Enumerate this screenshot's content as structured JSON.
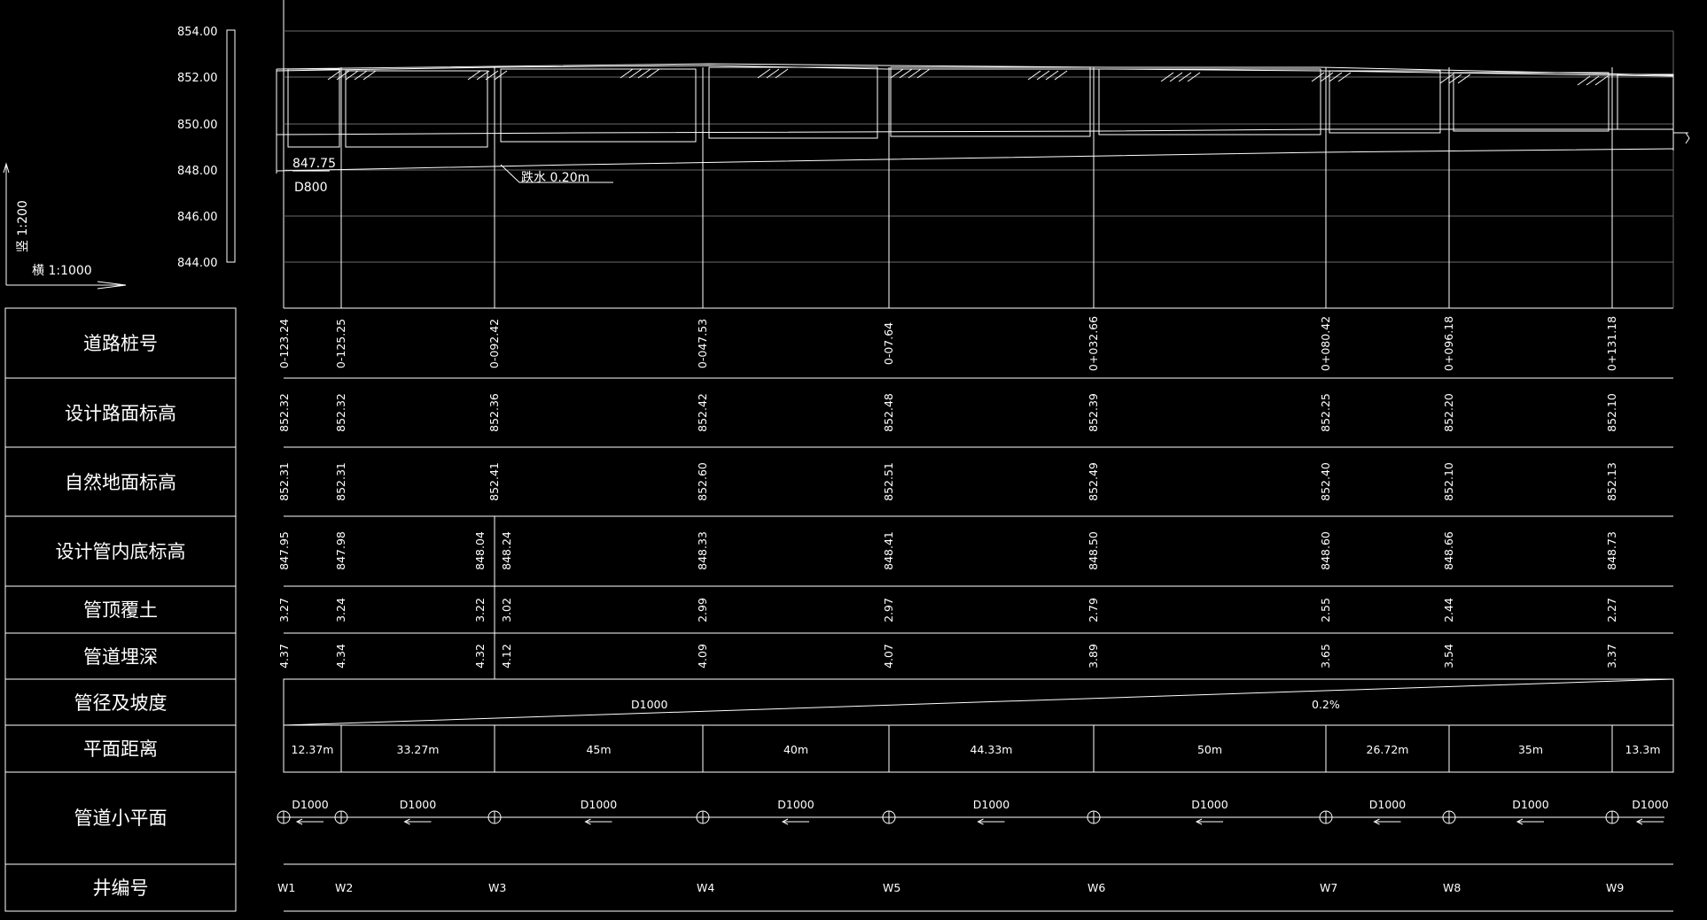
{
  "drawing": {
    "scale_vertical": "竖 1:200",
    "scale_horizontal": "横 1:1000",
    "elevation_axis": [
      "854.00",
      "852.00",
      "850.00",
      "848.00",
      "846.00",
      "844.00"
    ],
    "outlet_elevation": "847.75",
    "outlet_pipe": "D800",
    "drop_label": "跌水 0.20m"
  },
  "table": {
    "row_labels": {
      "station": "道路桩号",
      "road_elev": "设计路面标高",
      "ground_elev": "自然地面标高",
      "invert_elev": "设计管内底标高",
      "cover": "管顶覆土",
      "depth": "管道埋深",
      "diameter_slope": "管径及坡度",
      "distance": "平面距离",
      "plan": "管道小平面",
      "well_no": "井编号"
    },
    "stations": [
      "0-123.24",
      "0-125.25",
      "0-092.42",
      "0-047.53",
      "0-07.64",
      "0+032.66",
      "0+080.42",
      "0+096.18",
      "0+131.18"
    ],
    "road_elev": [
      "852.32",
      "852.32",
      "852.36",
      "852.42",
      "852.48",
      "852.39",
      "852.25",
      "852.20",
      "852.10"
    ],
    "ground_elev": [
      "852.31",
      "852.31",
      "852.41",
      "852.60",
      "852.51",
      "852.49",
      "852.40",
      "852.10",
      "852.13"
    ],
    "invert_elev": [
      "847.95",
      "847.98",
      "848.04",
      "848.24",
      "848.33",
      "848.41",
      "848.50",
      "848.60",
      "848.66",
      "848.73"
    ],
    "cover": [
      "3.27",
      "3.24",
      "3.22",
      "3.02",
      "2.99",
      "2.97",
      "2.79",
      "2.55",
      "2.44",
      "2.27"
    ],
    "depth": [
      "4.37",
      "4.34",
      "4.32",
      "4.12",
      "4.09",
      "4.07",
      "3.89",
      "3.65",
      "3.54",
      "3.37"
    ],
    "pipe_diameter": "D1000",
    "slope": "0.2%",
    "distances": [
      "12.37m",
      "33.27m",
      "45m",
      "40m",
      "44.33m",
      "50m",
      "26.72m",
      "35m",
      "13.3m"
    ],
    "plan_labels": [
      "D1000",
      "D1000",
      "D1000",
      "D1000",
      "D1000",
      "D1000",
      "D1000",
      "D1000",
      "D1000"
    ],
    "wells": [
      "W1",
      "W2",
      "W3",
      "W4",
      "W5",
      "W6",
      "W7",
      "W8",
      "W9"
    ]
  }
}
